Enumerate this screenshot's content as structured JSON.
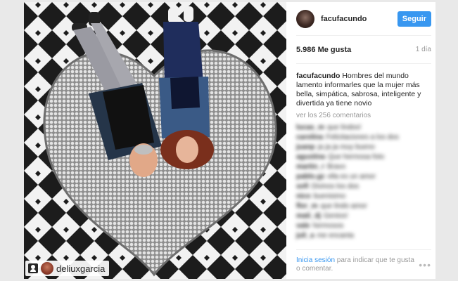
{
  "post": {
    "username": "facufacundo",
    "follow_label": "Seguir",
    "likes": "5.986 Me gusta",
    "time": "1 día",
    "caption_author": "facufacundo",
    "caption_text": "Hombres del mundo lamento informarles que la mujer más bella, simpática, sabrosa, inteligente y divertida ya tiene novio",
    "view_all": "ver los 256 comentarios"
  },
  "comments": [
    {
      "user": "lucas_m",
      "text": "que lindos!"
    },
    {
      "user": "carolina",
      "text": "Felicitaciones a los dos"
    },
    {
      "user": "juanp",
      "text": "ja ja ja muy bueno"
    },
    {
      "user": "agustina",
      "text": "Que hermosa foto"
    },
    {
      "user": "martin_r",
      "text": "Bravo"
    },
    {
      "user": "pablo.gz",
      "text": "ella es un amor"
    },
    {
      "user": "sofi",
      "text": "Divinos los dos"
    },
    {
      "user": "nico",
      "text": "buenisimo"
    },
    {
      "user": "flor_m",
      "text": "que lindo amor"
    },
    {
      "user": "mati_dj",
      "text": "Genios!"
    },
    {
      "user": "vale",
      "text": "hermosos"
    },
    {
      "user": "juli_a",
      "text": "me encanta"
    }
  ],
  "photo_tag": {
    "name": "deliuxgarcia"
  },
  "footer": {
    "login_link": "Inicia sesión",
    "login_rest": " para indicar que te gusta o comentar.",
    "more_icon": "•••"
  },
  "colors": {
    "accent": "#3897f0",
    "muted": "#999999",
    "text": "#262626"
  },
  "icons": {
    "tag": "person-tag-icon",
    "more": "more-options-icon"
  }
}
